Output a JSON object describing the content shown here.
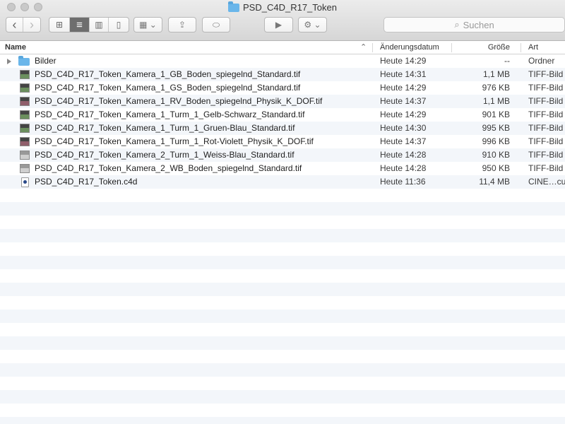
{
  "window": {
    "title": "PSD_C4D_R17_Token"
  },
  "toolbar": {
    "back_glyph": "‹",
    "forward_glyph": "›",
    "view_icon_glyph": "⊞",
    "view_list_glyph": "≡",
    "view_column_glyph": "▥",
    "view_coverflow_glyph": "▯",
    "arrange_glyph": "▦ ⌄",
    "share_glyph": "⇪",
    "tag_glyph": "⬭",
    "quicklook_glyph": "▶",
    "action_glyph": "⚙ ⌄"
  },
  "search": {
    "placeholder": "Suchen",
    "icon_glyph": "⌕"
  },
  "columns": {
    "name": "Name",
    "sort_glyph": "⌃",
    "date": "Änderungsdatum",
    "size": "Größe",
    "kind": "Art"
  },
  "files": [
    {
      "name": "Bilder",
      "date": "Heute 14:29",
      "size": "--",
      "kind": "Ordner",
      "icon": "folder-icon"
    },
    {
      "name": "PSD_C4D_R17_Token_Kamera_1_GB_Boden_spiegelnd_Standard.tif",
      "date": "Heute 14:31",
      "size": "1,1 MB",
      "kind": "TIFF-Bild",
      "icon": "tif-icon"
    },
    {
      "name": "PSD_C4D_R17_Token_Kamera_1_GS_Boden_spiegelnd_Standard.tif",
      "date": "Heute 14:29",
      "size": "976 KB",
      "kind": "TIFF-Bild",
      "icon": "tif-icon"
    },
    {
      "name": "PSD_C4D_R17_Token_Kamera_1_RV_Boden_spiegelnd_Physik_K_DOF.tif",
      "date": "Heute 14:37",
      "size": "1,1 MB",
      "kind": "TIFF-Bild",
      "icon": "tif-red-icon"
    },
    {
      "name": "PSD_C4D_R17_Token_Kamera_1_Turm_1_Gelb-Schwarz_Standard.tif",
      "date": "Heute 14:29",
      "size": "901 KB",
      "kind": "TIFF-Bild",
      "icon": "tif-icon"
    },
    {
      "name": "PSD_C4D_R17_Token_Kamera_1_Turm_1_Gruen-Blau_Standard.tif",
      "date": "Heute 14:30",
      "size": "995 KB",
      "kind": "TIFF-Bild",
      "icon": "tif-icon"
    },
    {
      "name": "PSD_C4D_R17_Token_Kamera_1_Turm_1_Rot-Violett_Physik_K_DOF.tif",
      "date": "Heute 14:37",
      "size": "996 KB",
      "kind": "TIFF-Bild",
      "icon": "tif-red-icon"
    },
    {
      "name": "PSD_C4D_R17_Token_Kamera_2_Turm_1_Weiss-Blau_Standard.tif",
      "date": "Heute 14:28",
      "size": "910 KB",
      "kind": "TIFF-Bild",
      "icon": "tif-white-icon"
    },
    {
      "name": "PSD_C4D_R17_Token_Kamera_2_WB_Boden_spiegelnd_Standard.tif",
      "date": "Heute 14:28",
      "size": "950 KB",
      "kind": "TIFF-Bild",
      "icon": "tif-white-icon"
    },
    {
      "name": "PSD_C4D_R17_Token.c4d",
      "date": "Heute 11:36",
      "size": "11,4 MB",
      "kind": "CINE…cument",
      "icon": "c4d-icon"
    }
  ]
}
